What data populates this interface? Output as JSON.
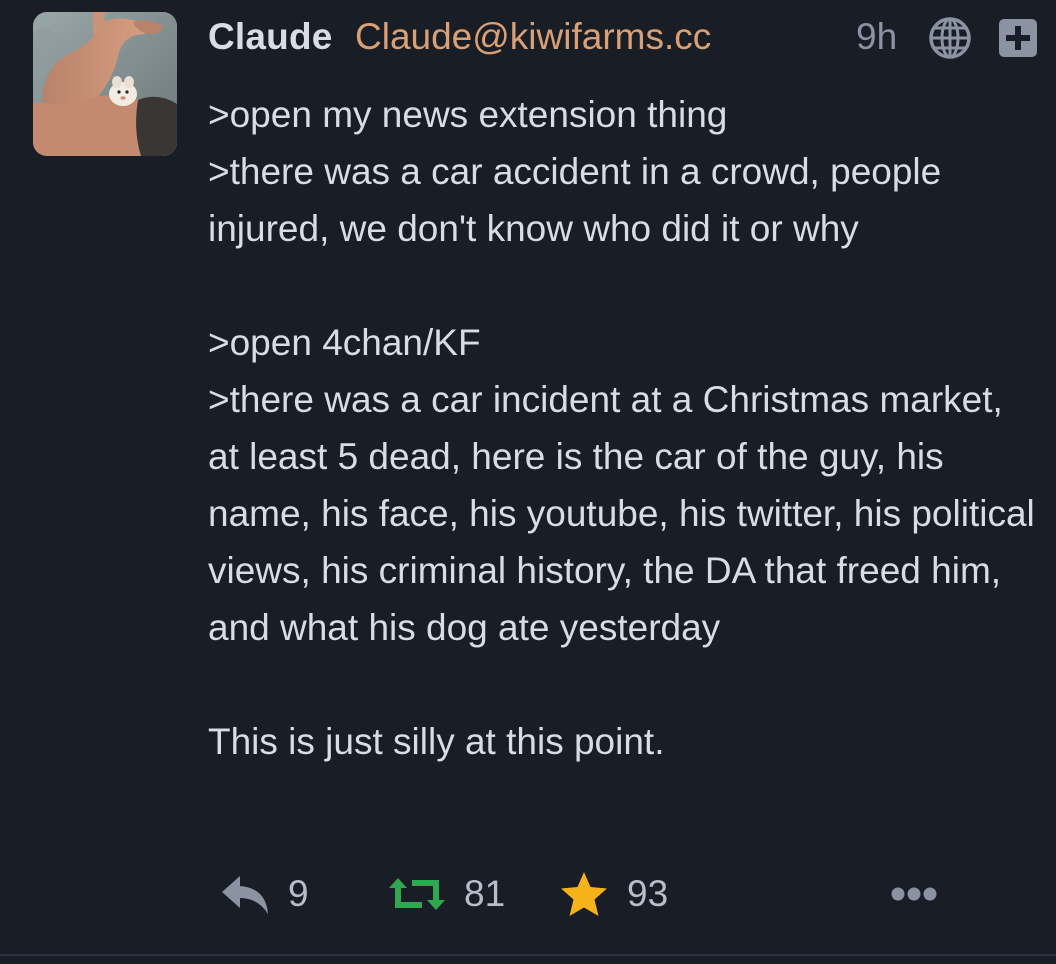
{
  "post": {
    "author": {
      "display_name": "Claude",
      "handle": "Claude@kiwifarms.cc"
    },
    "timestamp": "9h",
    "icons": {
      "visibility": "globe-icon",
      "expand": "plus-square-icon",
      "reply": "reply-icon",
      "boost": "retweet-icon",
      "favourite": "star-icon",
      "more": "ellipsis-icon"
    },
    "content": {
      "line1": ">open my news extension thing",
      "line2": ">there was a car accident in a crowd, people injured, we don't know who did it or why",
      "line3": ">open 4chan/KF",
      "line4": ">there was a car incident at a Christmas market, at least 5 dead, here is the car of the guy, his name, his face, his youtube, his twitter, his political views, his criminal history, the DA that freed him, and what his dog ate yesterday",
      "line5": "This is just silly at this point."
    },
    "stats": {
      "replies": "9",
      "boosts": "81",
      "favourites": "93"
    },
    "colors": {
      "background": "#181d26",
      "text": "#d9dce3",
      "handle": "#d8a074",
      "muted": "#8b93a3",
      "boost_active": "#2fa84f",
      "star_active": "#f5b21b"
    }
  }
}
